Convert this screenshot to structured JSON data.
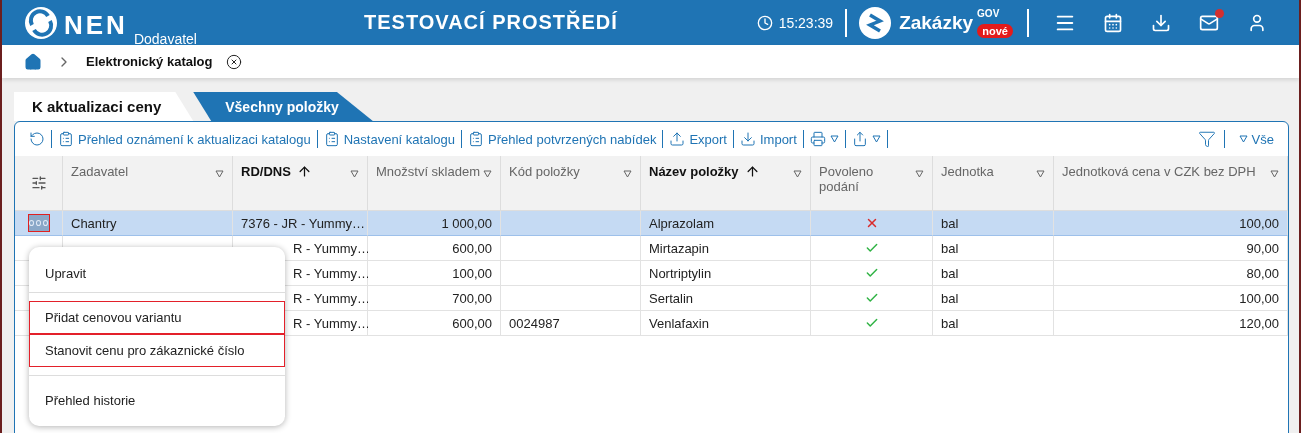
{
  "header": {
    "brand": "NEN",
    "brand_sub": "Dodavatel",
    "environment": "TESTOVACÍ PROSTŘEDÍ",
    "time": "15:23:39",
    "portal": "Zakázky",
    "portal_sup": "GOV",
    "portal_badge": "nové",
    "mail_notification": true
  },
  "breadcrumb": {
    "items": [
      "Elektronický katalog"
    ]
  },
  "tabs": [
    {
      "label": "K aktualizaci ceny",
      "selected": true
    },
    {
      "label": "Všechny položky",
      "selected": false
    }
  ],
  "toolbar": {
    "items": [
      {
        "kind": "refresh"
      },
      {
        "kind": "clipboard",
        "label": "Přehled oznámení k aktualizaci katalogu"
      },
      {
        "kind": "clipboard",
        "label": "Nastavení katalogu"
      },
      {
        "kind": "clipboard",
        "label": "Přehled potvrzených nabídek"
      },
      {
        "kind": "export",
        "label": "Export"
      },
      {
        "kind": "import",
        "label": "Import"
      },
      {
        "kind": "print"
      },
      {
        "kind": "share"
      }
    ],
    "filter_label": "Vše"
  },
  "table": {
    "columns": [
      {
        "label": "Zadavatel",
        "sorted": false
      },
      {
        "label": "RD/DNS",
        "sorted": true
      },
      {
        "label": "Množství skladem",
        "sorted": false
      },
      {
        "label": "Kód položky",
        "sorted": false
      },
      {
        "label": "Název položky",
        "sorted": true
      },
      {
        "label": "Povoleno podání",
        "sorted": false
      },
      {
        "label": "Jednotka",
        "sorted": false
      },
      {
        "label": "Jednotková cena v CZK bez DPH",
        "sorted": false
      }
    ],
    "rows": [
      {
        "selected": true,
        "zadavatel": "Chantry",
        "rd_dns": "7376 - JR - Yummy…",
        "stock": "1 000,00",
        "name": "Alprazolam",
        "allowed": false,
        "unit": "bal",
        "price": "100,00"
      },
      {
        "selected": false,
        "rd_dns": "R - Yummy…",
        "stock": "600,00",
        "name": "Mirtazapin",
        "allowed": true,
        "unit": "bal",
        "price": "90,00"
      },
      {
        "selected": false,
        "rd_dns": "R - Yummy…",
        "stock": "100,00",
        "name": "Nortriptylin",
        "allowed": true,
        "unit": "bal",
        "price": "80,00"
      },
      {
        "selected": false,
        "rd_dns": "R - Yummy…",
        "stock": "700,00",
        "name": "Sertalin",
        "allowed": true,
        "unit": "bal",
        "price": "100,00"
      },
      {
        "selected": false,
        "rd_dns": "R - Yummy…",
        "stock": "600,00",
        "code": "0024987",
        "name": "Venlafaxin",
        "allowed": true,
        "unit": "bal",
        "price": "120,00"
      }
    ]
  },
  "context_menu": {
    "items": [
      {
        "label": "Upravit",
        "highlighted": false
      },
      {
        "label": "Přidat cenovou variantu",
        "highlighted": true
      },
      {
        "label": "Stanovit cenu pro zákaznické číslo",
        "highlighted": true
      },
      {
        "label": "Přehled historie",
        "highlighted": false
      }
    ]
  }
}
